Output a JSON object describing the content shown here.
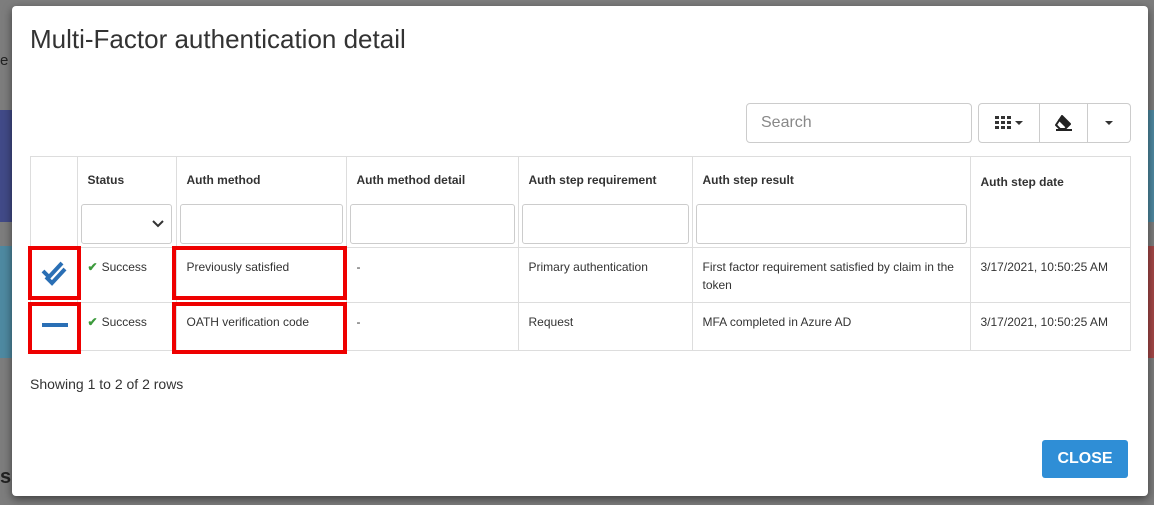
{
  "background": {
    "left_text_fragment": "e I",
    "bottom_text_fragment": "s",
    "accent_colors": [
      "#2d3a8c",
      "#3a8fb0",
      "#b53030"
    ]
  },
  "modal": {
    "title": "Multi-Factor authentication detail",
    "search": {
      "placeholder": "Search"
    },
    "toolbar": {
      "columns_icon": "grid-icon",
      "clear_icon": "eraser-icon",
      "export_icon": "caret-down-icon"
    },
    "table": {
      "headers": [
        "Status",
        "Auth method",
        "Auth method detail",
        "Auth step requirement",
        "Auth step result",
        "Auth step date"
      ],
      "rows": [
        {
          "icon": "double-check-icon",
          "status": "Success",
          "auth_method": "Previously satisfied",
          "auth_method_detail": "-",
          "requirement": "Primary authentication",
          "result": "First factor requirement satisfied by claim in the token",
          "date": "3/17/2021, 10:50:25 AM"
        },
        {
          "icon": "dash-icon",
          "status": "Success",
          "auth_method": "OATH verification code",
          "auth_method_detail": "-",
          "requirement": "Request",
          "result": "MFA completed in Azure AD",
          "date": "3/17/2021, 10:50:25 AM"
        }
      ]
    },
    "footer": {
      "pagination_text": "Showing 1 to 2 of 2 rows"
    },
    "close_label": "CLOSE"
  },
  "colors": {
    "success": "#3c9a3c",
    "highlight": "#ee0000",
    "primary_button": "#2f8ed6",
    "icon_blue": "#2a6fb5"
  }
}
